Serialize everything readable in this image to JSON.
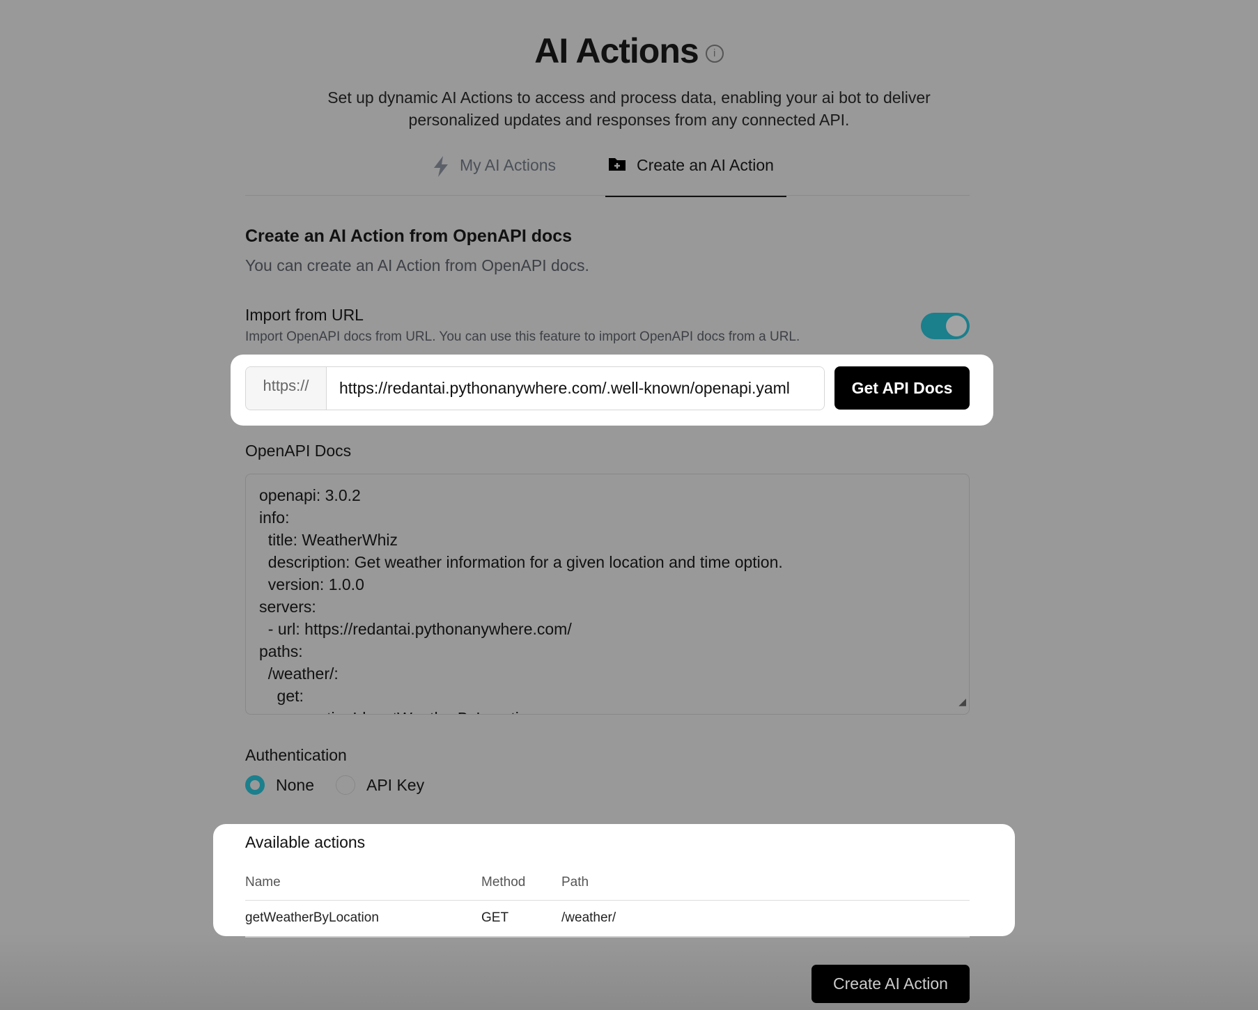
{
  "header": {
    "title": "AI Actions",
    "info_icon": "i",
    "subtitle": "Set up dynamic AI Actions to access and process data, enabling your ai bot to deliver personalized updates and responses from any connected API."
  },
  "tabs": [
    {
      "label": "My AI Actions",
      "icon": "lightning-icon",
      "active": false
    },
    {
      "label": "Create an AI Action",
      "icon": "folder-plus-icon",
      "active": true
    }
  ],
  "section": {
    "title": "Create an AI Action from OpenAPI docs",
    "subtitle": "You can create an AI Action from OpenAPI docs."
  },
  "import": {
    "label": "Import from URL",
    "description": "Import OpenAPI docs from URL. You can use this feature to import OpenAPI docs from a URL.",
    "enabled": true,
    "prefix": "https://",
    "url": "https://redantai.pythonanywhere.com/.well-known/openapi.yaml",
    "button": "Get API Docs"
  },
  "docs": {
    "label": "OpenAPI Docs",
    "content": "openapi: 3.0.2\ninfo:\n  title: WeatherWhiz\n  description: Get weather information for a given location and time option.\n  version: 1.0.0\nservers:\n  - url: https://redantai.pythonanywhere.com/\npaths:\n  /weather/:\n    get:\n      operationId: getWeatherByLocation"
  },
  "auth": {
    "label": "Authentication",
    "options": [
      "None",
      "API Key"
    ],
    "selected": "None"
  },
  "actions": {
    "title": "Available actions",
    "columns": [
      "Name",
      "Method",
      "Path"
    ],
    "rows": [
      {
        "name": "getWeatherByLocation",
        "method": "GET",
        "path": "/weather/"
      }
    ]
  },
  "footer": {
    "create_button": "Create AI Action"
  },
  "colors": {
    "accent": "#1b7f8c",
    "overlay": "#999999"
  }
}
